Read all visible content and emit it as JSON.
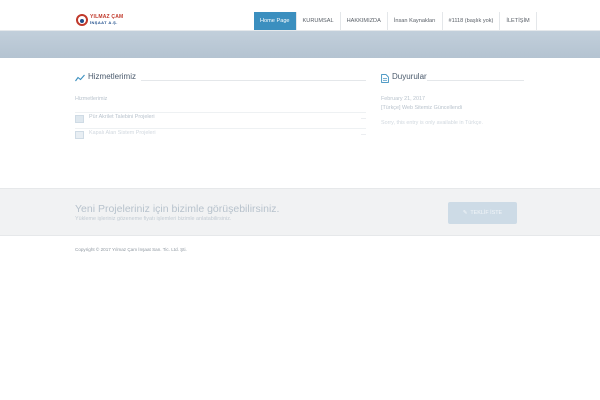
{
  "brand": {
    "line1": "YILMAZ ÇAM",
    "line2": "İNŞAAT A.Ş."
  },
  "nav": {
    "items": [
      {
        "label": "Home Page"
      },
      {
        "label": "KURUMSAL"
      },
      {
        "label": "HAKKIMIZDA"
      },
      {
        "label": "İnsan Kaynakları"
      },
      {
        "label": "#1118 (başlık yok)"
      },
      {
        "label": "İLETİŞİM"
      }
    ]
  },
  "services": {
    "title": "Hizmetlerimiz",
    "subtitle": "Hizmetlerimiz",
    "items": [
      {
        "label": "Pür Akrilet Talebini Projeleri"
      },
      {
        "label": "Kapalı Alan Sistem Projeleri"
      }
    ]
  },
  "announcements": {
    "title": "Duyurular",
    "date": "February 21, 2017",
    "link": "[Türkçe] Web Sitemiz Güncellendi",
    "body": "Sorry, this entry is only available in Türkçe."
  },
  "cta": {
    "title": "Yeni Projeleriniz için bizimle görüşebilirsiniz.",
    "subtitle": "Yükleme işleriniz gözeneme fiyatı işlemleri bizimle anlatabilirsiniz.",
    "button_label": "TEKLİF İSTE"
  },
  "footer": {
    "copyright": "Copyright © 2017 Yılmaz Çam İnşaat San. Tic. Ltd. Şti."
  },
  "colors": {
    "nav_active": "#3b8fbf",
    "banner": "#b9c8d6",
    "cta_button": "#cddbe6"
  }
}
